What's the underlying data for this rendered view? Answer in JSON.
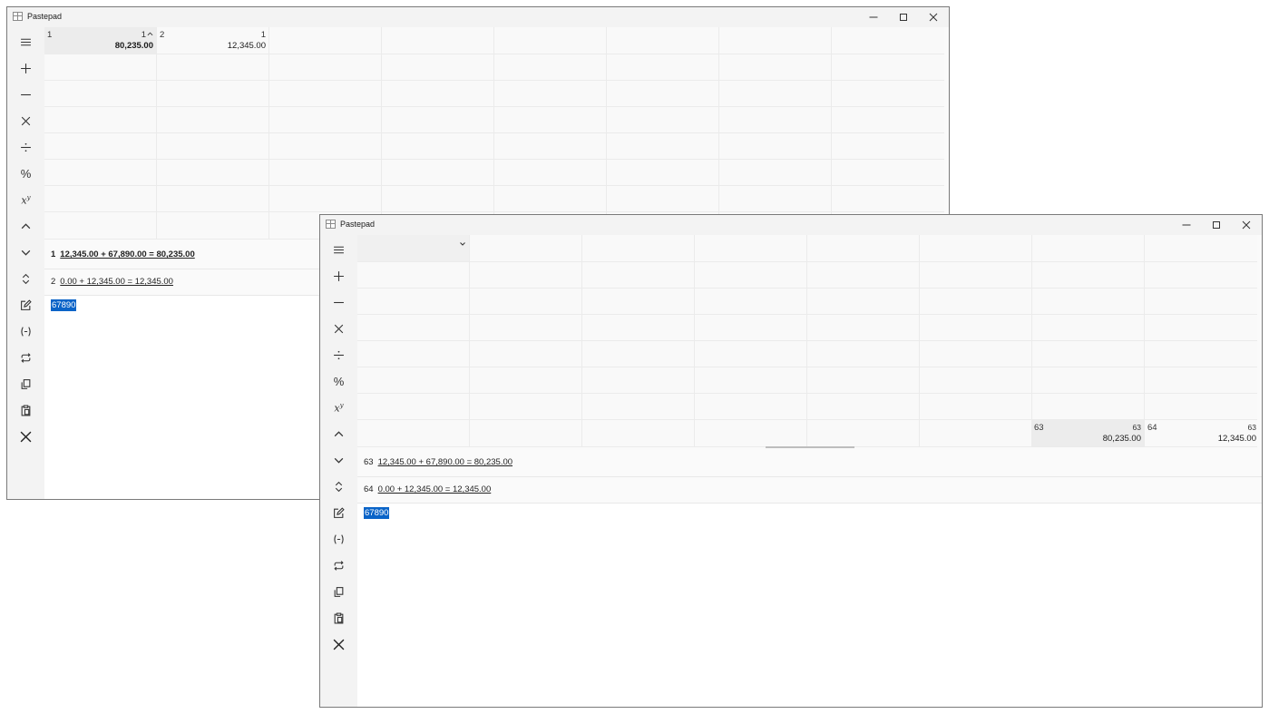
{
  "colors": {
    "selection": "#0a64c8",
    "toolbar_bg": "#f3f3f3",
    "grid_bg": "#f9f9f9"
  },
  "toolbar_icons": [
    "menu-icon",
    "plus-icon",
    "minus-icon",
    "multiply-icon",
    "divide-icon",
    "percent-icon",
    "power-icon",
    "chevron-up-icon",
    "chevron-down-icon",
    "sort-icon",
    "edit-icon",
    "negate-icon",
    "repeat-icon",
    "copy-icon",
    "paste-icon",
    "clear-icon"
  ],
  "toolbar": {
    "percent_label": "%",
    "power_base": "x",
    "power_exp": "y"
  },
  "window1": {
    "title": "Pastepad",
    "cells": [
      {
        "index": "1",
        "ref": "1",
        "value": "80,235.00"
      },
      {
        "index": "2",
        "ref": "1",
        "value": "12,345.00"
      }
    ],
    "history": [
      {
        "num": "1",
        "expr": "12,345.00 + 67,890.00 = 80,235.00"
      },
      {
        "num": "2",
        "expr": "0.00 + 12,345.00 = 12,345.00"
      }
    ],
    "input": "67890"
  },
  "window2": {
    "title": "Pastepad",
    "cells": [
      {
        "index": "63",
        "ref": "63",
        "value": "80,235.00"
      },
      {
        "index": "64",
        "ref": "63",
        "value": "12,345.00"
      }
    ],
    "history": [
      {
        "num": "63",
        "expr": "12,345.00 + 67,890.00 = 80,235.00"
      },
      {
        "num": "64",
        "expr": "0.00 + 12,345.00 = 12,345.00"
      }
    ],
    "input": "67890"
  }
}
